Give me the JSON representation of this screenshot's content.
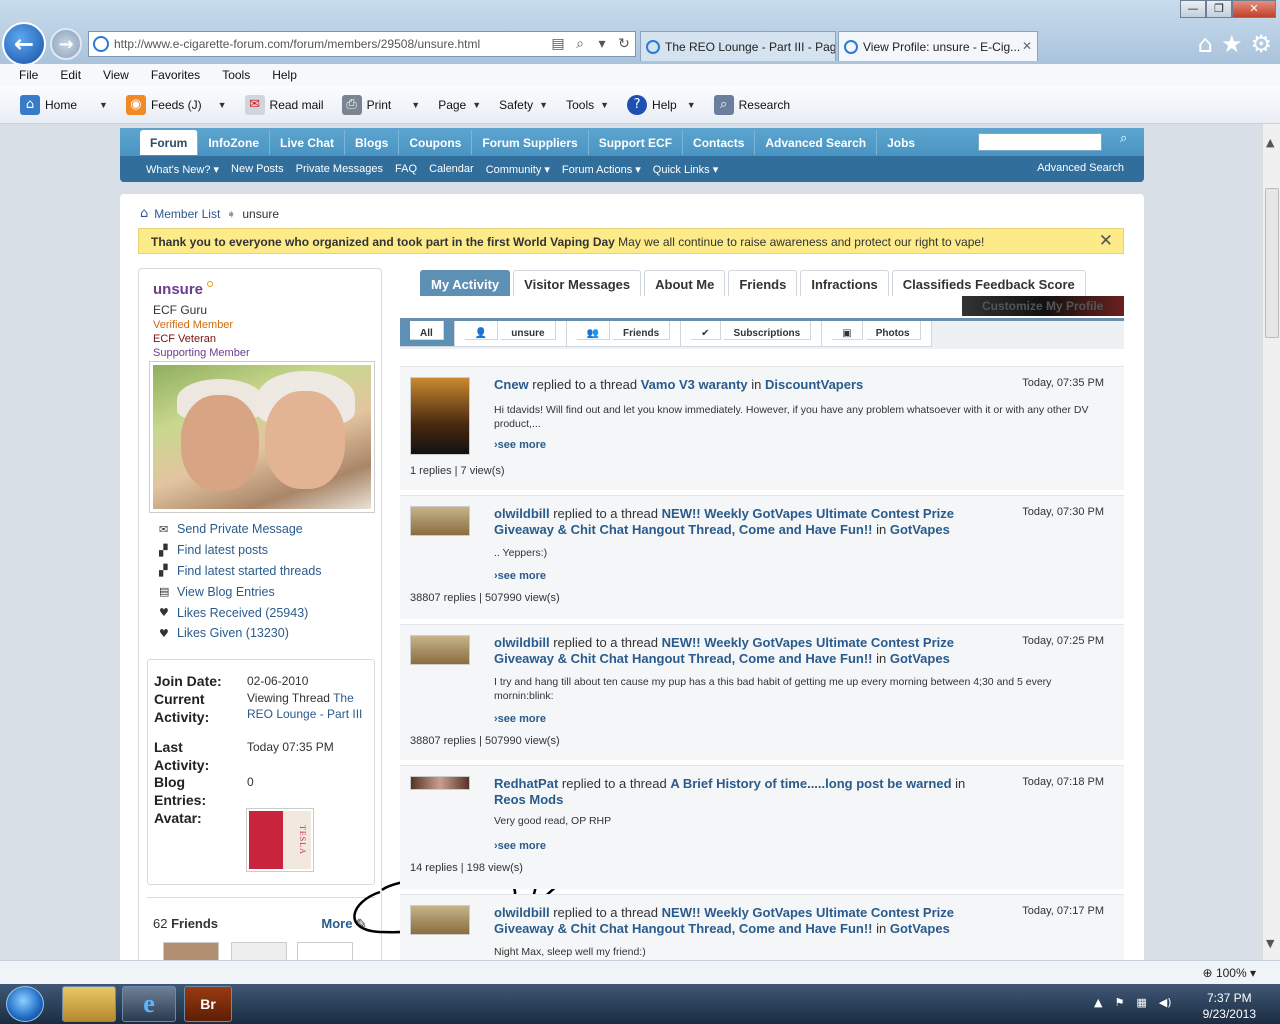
{
  "browser": {
    "address": "http://www.e-cigarette-forum.com/forum/members/29508/unsure.html",
    "tabs": [
      {
        "label": "The REO Lounge - Part III - Pag..."
      },
      {
        "label": "View Profile: unsure - E-Cig..."
      }
    ],
    "menu": [
      "File",
      "Edit",
      "View",
      "Favorites",
      "Tools",
      "Help"
    ],
    "commands": [
      "Home",
      "Feeds (J)",
      "Read mail",
      "Print",
      "Page",
      "Safety",
      "Tools",
      "Help",
      "Research"
    ],
    "zoom": "100%"
  },
  "site": {
    "tabs": [
      "Forum",
      "InfoZone",
      "Live Chat",
      "Blogs",
      "Coupons",
      "Forum Suppliers",
      "Support ECF",
      "Contacts",
      "Advanced Search",
      "Jobs"
    ],
    "subnav": [
      "What's New? ▾",
      "New Posts",
      "Private Messages",
      "FAQ",
      "Calendar",
      "Community ▾",
      "Forum Actions ▾",
      "Quick Links ▾"
    ],
    "subnav_right": "Advanced Search"
  },
  "breadcrumb": {
    "root": "Member List",
    "current": "unsure"
  },
  "notice": {
    "bold": "Thank you to everyone who organized and took part in the first World Vaping Day",
    "text": " May we all continue to raise awareness and protect our right to vape!"
  },
  "profile": {
    "username": "unsure",
    "title": "ECF Guru",
    "badges": [
      {
        "label": "Verified Member",
        "color": "#d06a10"
      },
      {
        "label": "ECF Veteran",
        "color": "#7a1010"
      },
      {
        "label": "Supporting Member",
        "color": "#6b3c8f"
      }
    ],
    "actions": [
      {
        "label": "Send Private Message",
        "icon": "envelope-icon"
      },
      {
        "label": "Find latest posts",
        "icon": "posts-icon"
      },
      {
        "label": "Find latest started threads",
        "icon": "threads-icon"
      },
      {
        "label": "View Blog Entries",
        "icon": "blog-icon"
      },
      {
        "label": "Likes Received (25943)",
        "icon": "heart-icon"
      },
      {
        "label": "Likes Given (13230)",
        "icon": "heart-icon"
      }
    ],
    "join_date_label": "Join Date:",
    "join_date": "02-06-2010",
    "activity_label_1": "Current",
    "activity_label_2": "Activity:",
    "activity_prefix": "Viewing Thread ",
    "activity_link": "The REO Lounge - Part III",
    "last_label_1": "Last",
    "last_label_2": "Activity:",
    "last_activity": "Today 07:35 PM",
    "blog_label_1": "Blog",
    "blog_label_2": "Entries:",
    "blog_entries": "0",
    "avatar_label": "Avatar:",
    "avatar_text": "TESLA",
    "friends_count": "62",
    "friends_label": " Friends",
    "friends_more": "More"
  },
  "profile_tabs": [
    "My Activity",
    "Visitor Messages",
    "About Me",
    "Friends",
    "Infractions",
    "Classifieds Feedback Score"
  ],
  "customize": "Customize My Profile",
  "filter_tabs": [
    "All",
    "unsure",
    "Friends",
    "Subscriptions",
    "Photos"
  ],
  "feed": [
    {
      "user": "Cnew",
      "verb": " replied to a thread ",
      "thread": "Vamo V3 waranty",
      "in": " in ",
      "forum": "DiscountVapers",
      "date": "Today, 07:35 PM",
      "body": "Hi tdavids! Will find out and let you know immediately. However, if you have any problem whatsoever with it or with any other DV product,...",
      "see": "see more",
      "stats": "1 replies | 7 view(s)"
    },
    {
      "user": "olwildbill",
      "verb": " replied to a thread ",
      "thread": "NEW!! Weekly GotVapes Ultimate Contest Prize Giveaway & Chit Chat Hangout Thread, Come and Have Fun!!",
      "in": " in ",
      "forum": "GotVapes",
      "date": "Today, 07:30 PM",
      "body": ".. Yeppers:)",
      "see": "see more",
      "stats": "38807 replies | 507990 view(s)"
    },
    {
      "user": "olwildbill",
      "verb": " replied to a thread ",
      "thread": "NEW!! Weekly GotVapes Ultimate Contest Prize Giveaway & Chit Chat Hangout Thread, Come and Have Fun!!",
      "in": " in ",
      "forum": "GotVapes",
      "date": "Today, 07:25 PM",
      "body": "I try and hang till about ten cause my pup has a this bad habit of getting me up every morning between 4;30 and 5 every mornin:blink:",
      "see": "see more",
      "stats": "38807 replies | 507990 view(s)"
    },
    {
      "user": "RedhatPat",
      "verb": " replied to a thread ",
      "thread": "A Brief History of time.....long post be warned",
      "in": " in ",
      "forum": "Reos Mods",
      "date": "Today, 07:18 PM",
      "body": "Very good read, OP RHP",
      "see": "see more",
      "stats": "14 replies | 198 view(s)"
    },
    {
      "user": "olwildbill",
      "verb": " replied to a thread ",
      "thread": "NEW!! Weekly GotVapes Ultimate Contest Prize Giveaway & Chit Chat Hangout Thread, Come and Have Fun!!",
      "in": " in ",
      "forum": "GotVapes",
      "date": "Today, 07:17 PM",
      "body": "Night Max, sleep well my friend:)",
      "see": "",
      "stats": ""
    }
  ],
  "taskbar": {
    "time": "7:37 PM",
    "date": "9/23/2013",
    "app": "Br"
  }
}
